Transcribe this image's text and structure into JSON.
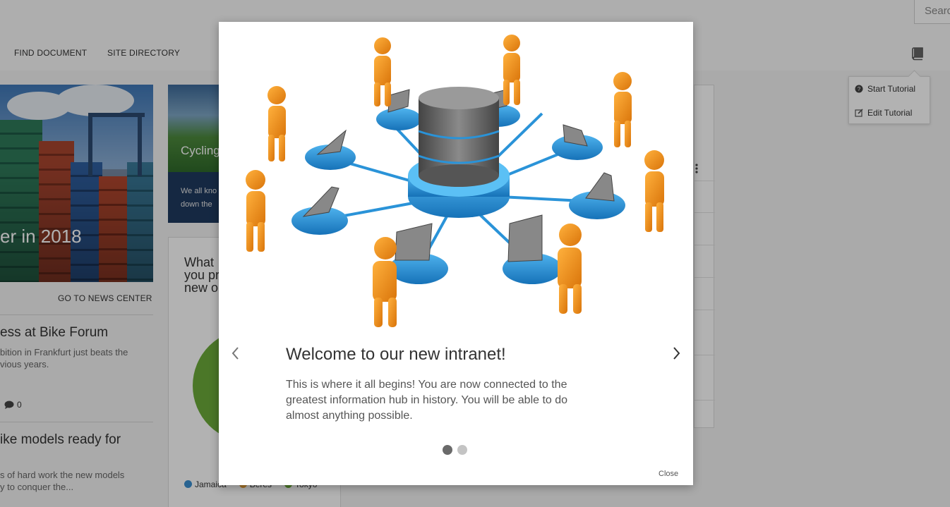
{
  "search": {
    "placeholder": "Search"
  },
  "nav": {
    "items": [
      "FIND DOCUMENT",
      "SITE DIRECTORY"
    ]
  },
  "tutorial_menu": {
    "start": "Start Tutorial",
    "edit": "Edit Tutorial"
  },
  "news": {
    "headline": "er in 2018",
    "go_label": "GO TO NEWS CENTER",
    "articles": [
      {
        "title": "ess at Bike Forum",
        "desc": "bition in Frankfurt just beats the\nvious years.",
        "comments": "0"
      },
      {
        "title": "ike models ready for",
        "desc": "s of hard work the new models\ny to conquer the..."
      }
    ]
  },
  "cycling": {
    "title": "Cycling",
    "desc_line1": "We all kno",
    "desc_line2": "down the"
  },
  "poll": {
    "question": "What you pr new o",
    "legend": [
      {
        "name": "Jamaica",
        "color": "#3a8fd0"
      },
      {
        "name": "Beres",
        "color": "#e8a23a"
      },
      {
        "name": "Tokyo",
        "color": "#6cab3a"
      }
    ]
  },
  "modal": {
    "title": "Welcome to our new intranet!",
    "body": "This is where it all begins! You are now connected to the greatest information hub in history. You will be able to do almost anything possible.",
    "close": "Close",
    "slide_count": 2,
    "active_slide": 1
  },
  "colors": {
    "accent": "#1f8fd6",
    "figure": "#f39c12",
    "server": "#6b6b6b"
  }
}
